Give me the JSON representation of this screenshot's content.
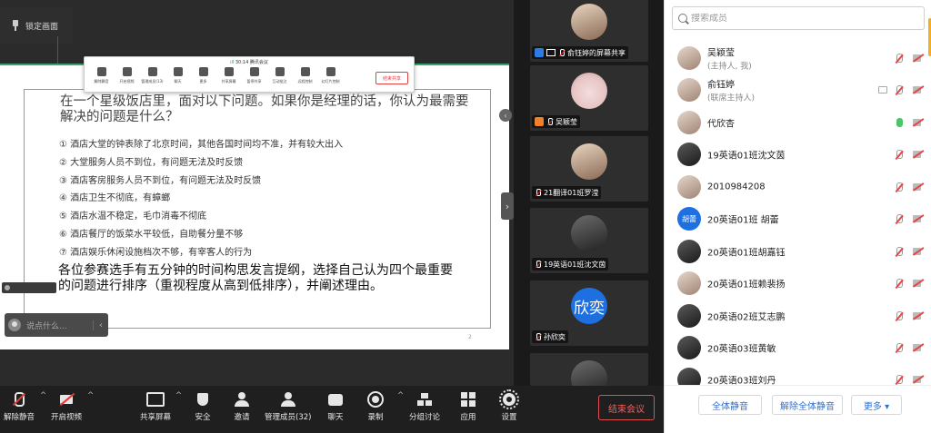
{
  "stage": {
    "lock_label": "锁定画面"
  },
  "slide": {
    "title": "在一个星级饭店里，面对以下问题。如果你是经理的话，你认为最需要解决的问题是什么？",
    "items": [
      "① 酒店大堂的钟表除了北京时间，其他各国时间均不准，并有较大出入",
      "② 大堂服务人员不到位，有问题无法及时反馈",
      "③ 酒店客房服务人员不到位，有问题无法及时反馈",
      "④ 酒店卫生不彻底，有蟑螂",
      "⑤ 酒店水温不稳定，毛巾消毒不彻底",
      "⑥ 酒店餐厅的饭菜水平较低，自助餐分量不够",
      "⑦ 酒店娱乐休闲设施档次不够，有宰客人的行为"
    ],
    "paragraph": "各位参赛选手有五分钟的时间构思发言提纲，选择自己认为四个最重要的问题进行排序（重视程度从高到低排序），并阐述理由。",
    "page_number": "2"
  },
  "inner_toolbar": {
    "time": "30:14",
    "title": "腾讯会议",
    "items": [
      "解除静音",
      "开启视频",
      "管理成员(13)",
      "聊天",
      "更多",
      "共享屏幕",
      "暂停共享",
      "互动批注",
      "远程控制",
      "幻灯片控制"
    ],
    "end_label": "结束共享"
  },
  "chat": {
    "placeholder": "说点什么..."
  },
  "video_tiles": [
    {
      "name": "俞钰婷的屏幕共享",
      "badge": "share",
      "face": "light"
    },
    {
      "name": "吴颖莹",
      "badge": "host",
      "face": "cat"
    },
    {
      "name": "21翻译01班罗滢",
      "badge": "none",
      "face": "light"
    },
    {
      "name": "19英语01班沈文茵",
      "badge": "none",
      "face": "dark"
    },
    {
      "name": "孙欣奕",
      "badge": "none",
      "face": "text",
      "face_text": "欣奕"
    }
  ],
  "toolbar": {
    "buttons": [
      {
        "label": "解除静音",
        "icon": "mic-muted-icon",
        "caret": true
      },
      {
        "label": "开启视频",
        "icon": "camera-off-icon",
        "caret": true
      },
      {
        "label": "共享屏幕",
        "icon": "share-screen-icon",
        "caret": true
      },
      {
        "label": "安全",
        "icon": "shield-icon",
        "caret": false
      },
      {
        "label": "邀请",
        "icon": "invite-icon",
        "caret": false
      },
      {
        "label": "管理成员(32)",
        "icon": "members-icon",
        "caret": false
      },
      {
        "label": "聊天",
        "icon": "chat-icon",
        "caret": false
      },
      {
        "label": "录制",
        "icon": "record-icon",
        "caret": true
      },
      {
        "label": "分组讨论",
        "icon": "group-icon",
        "caret": false
      },
      {
        "label": "应用",
        "icon": "apps-icon",
        "caret": false
      },
      {
        "label": "设置",
        "icon": "gear-icon",
        "caret": false
      }
    ],
    "end_meeting": "结束会议"
  },
  "members": {
    "search_placeholder": "搜索成员",
    "list": [
      {
        "name": "吴颖莹",
        "role": "(主持人, 我)",
        "mic": "muted",
        "cam": "off",
        "avatar": "light"
      },
      {
        "name": "俞钰婷",
        "role": "(联席主持人)",
        "mic": "muted",
        "cam": "off",
        "screen": true,
        "avatar": "light"
      },
      {
        "name": "代欣杏",
        "role": "",
        "mic": "active",
        "cam": "off",
        "avatar": "light"
      },
      {
        "name": "19英语01班沈文茵",
        "role": "",
        "mic": "muted",
        "cam": "off",
        "avatar": "dark"
      },
      {
        "name": "2010984208",
        "role": "",
        "mic": "muted",
        "cam": "off",
        "avatar": "light"
      },
      {
        "name": "20英语01班 胡蕾",
        "role": "",
        "mic": "muted",
        "cam": "off",
        "avatar": "text",
        "avatar_text": "胡蕾"
      },
      {
        "name": "20英语01班胡嘉钰",
        "role": "",
        "mic": "muted",
        "cam": "off",
        "avatar": "dark"
      },
      {
        "name": "20英语01班赖裴扬",
        "role": "",
        "mic": "muted",
        "cam": "off",
        "avatar": "light"
      },
      {
        "name": "20英语02班艾志鹏",
        "role": "",
        "mic": "muted",
        "cam": "off",
        "avatar": "dark"
      },
      {
        "name": "20英语03班黄敏",
        "role": "",
        "mic": "muted",
        "cam": "off",
        "avatar": "dark"
      },
      {
        "name": "20英语03班刘丹",
        "role": "",
        "mic": "muted",
        "cam": "off",
        "avatar": "dark"
      }
    ],
    "footer": {
      "mute_all": "全体静音",
      "unmute_all": "解除全体静音",
      "more": "更多 ▾"
    }
  },
  "colors": {
    "accent": "#2d6fd6",
    "danger": "#e05050",
    "mic_active": "#4cc46a"
  }
}
